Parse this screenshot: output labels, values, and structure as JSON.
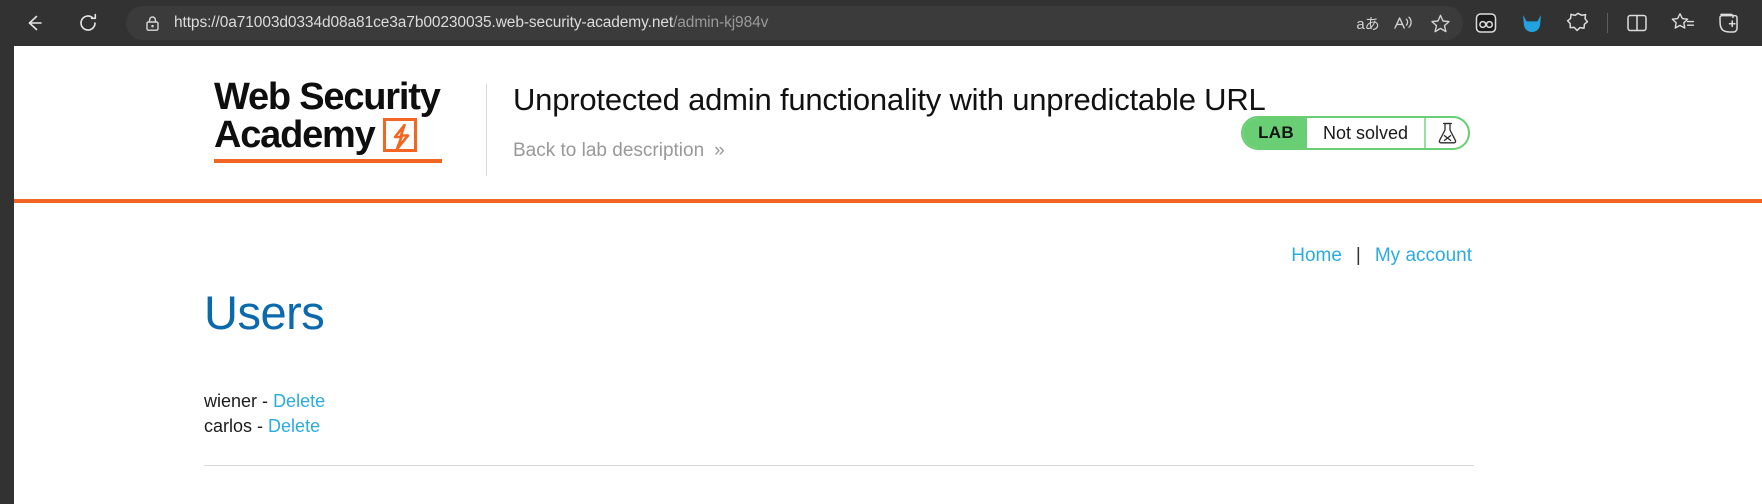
{
  "browser": {
    "back_label": "Back",
    "reload_label": "Refresh",
    "lock_label": "site-information",
    "url_host": "https://0a71003d0334d08a81ce3a7b00230035.web-security-academy.net",
    "url_path": "/admin-kj984v",
    "address_actions": [
      {
        "name": "read-aloud-translate-icon",
        "glyph": "aあ"
      },
      {
        "name": "read-aloud-icon",
        "glyph": "A"
      },
      {
        "name": "favorite-star-icon",
        "glyph": "☆"
      }
    ],
    "toolbar_icons": [
      {
        "name": "extension-oo-icon",
        "label": "oo"
      },
      {
        "name": "cat-extension-icon",
        "label": "cat"
      },
      {
        "name": "browser-essentials-icon",
        "label": "browser essentials"
      },
      {
        "name": "split-screen-icon",
        "label": "split screen"
      },
      {
        "name": "add-favorite-icon",
        "label": "add to favorites"
      },
      {
        "name": "collections-icon",
        "label": "collections"
      }
    ]
  },
  "academy": {
    "logo_line1": "Web Security",
    "logo_line2": "Academy",
    "lab_title": "Unprotected admin functionality with unpredictable URL",
    "back_link": "Back to lab description",
    "back_link_chevron": "»",
    "status": {
      "tag": "LAB",
      "state": "Not solved",
      "flask_icon": "not-solved-flask-icon"
    },
    "accent_orange": "#f26522",
    "accent_green": "#6ace74"
  },
  "page": {
    "nav": {
      "home": "Home",
      "separator": "|",
      "my_account": "My account"
    },
    "heading": "Users",
    "link_blue": "#2aabe2",
    "heading_blue": "#0b6aad",
    "users": [
      {
        "name": "wiener",
        "dash": "-",
        "action": "Delete"
      },
      {
        "name": "carlos",
        "dash": "-",
        "action": "Delete"
      }
    ]
  }
}
